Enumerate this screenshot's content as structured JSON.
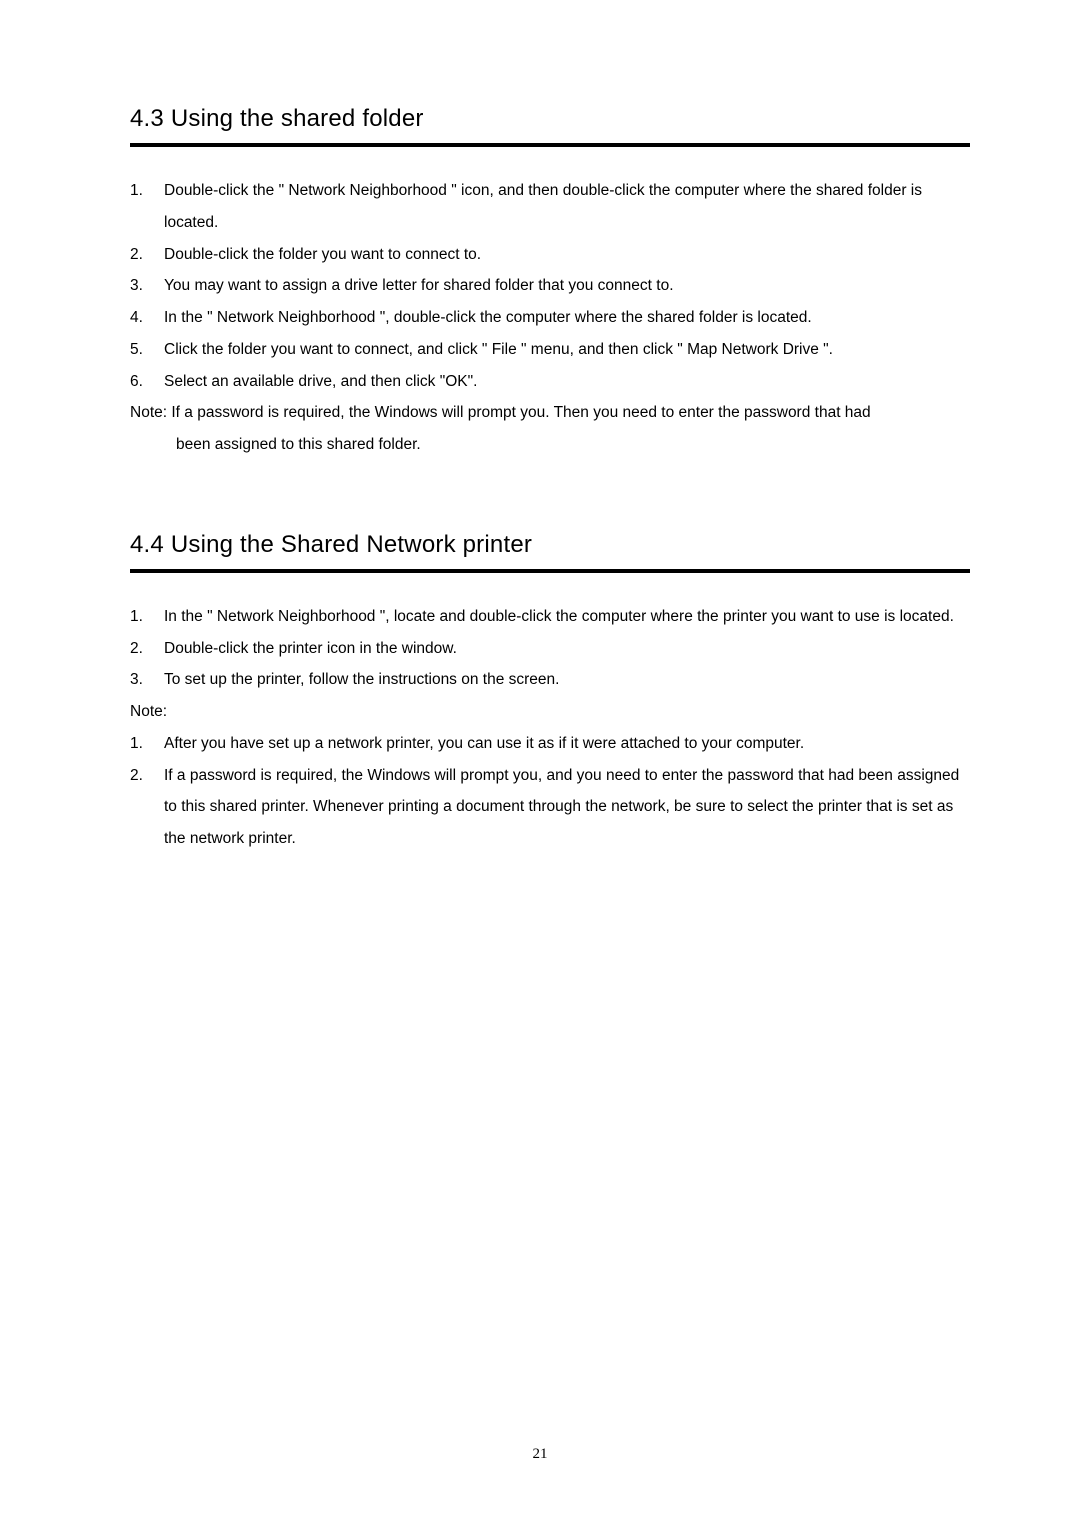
{
  "section43": {
    "heading": "4.3   Using the shared folder",
    "items": [
      "Double-click the \" Network Neighborhood \" icon, and then double-click the computer where the shared folder is located.",
      "Double-click the folder you want to connect to.",
      "You may want to assign a drive letter for shared folder that you connect to.",
      "In the \" Network Neighborhood \", double-click the computer where the shared folder is located.",
      "Click the folder you want to connect, and click \" File \" menu, and then click \" Map Network Drive \".",
      "Select an available drive, and then click \"OK\"."
    ],
    "note_line1": "Note: If a password is required, the Windows will prompt you. Then you need to enter the password that had",
    "note_line2": "been assigned to this shared folder."
  },
  "section44": {
    "heading": "4.4   Using the Shared Network printer",
    "items": [
      "In the \" Network Neighborhood \", locate and double-click the computer where the printer you want to use is located.",
      "Double-click the printer icon in the window.",
      "To set up the printer, follow the instructions on the screen."
    ],
    "note_label": "Note:",
    "note_items": [
      "After you have set up a network printer, you can use it as if it were attached to your computer.",
      "If a password is required, the Windows will prompt you, and you need to enter the password that had been assigned to this shared printer. Whenever printing a document through the network, be sure to select the printer that is set as the network printer."
    ]
  },
  "page_number": "21"
}
